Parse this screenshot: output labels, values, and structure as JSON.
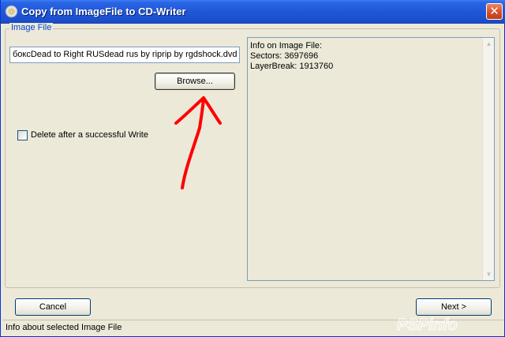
{
  "window": {
    "title": "Copy from ImageFile to CD-Writer",
    "close_glyph": "✕"
  },
  "image_file": {
    "group_label": "Image File",
    "path_value": "боксDead to Right RUSdead rus by riprip by rgdshock.dvd",
    "browse_label": "Browse...",
    "delete_checkbox_label": "Delete after a successful Write",
    "delete_checked": false
  },
  "info_panel": {
    "lines": [
      "Info on Image File:",
      "Sectors: 3697696",
      "LayerBreak: 1913760"
    ]
  },
  "buttons": {
    "cancel_label": "Cancel",
    "next_label": "Next >"
  },
  "status_bar": {
    "text": "Info about selected Image File"
  },
  "watermark": {
    "text": "PSPinfo"
  },
  "colors": {
    "titlebar": "#1f57d8",
    "annotation_arrow": "#ff0000",
    "group_label": "#0046d5"
  },
  "icons": [
    "app-icon",
    "close-icon",
    "scroll-up-icon",
    "scroll-down-icon",
    "annotation-arrow"
  ]
}
